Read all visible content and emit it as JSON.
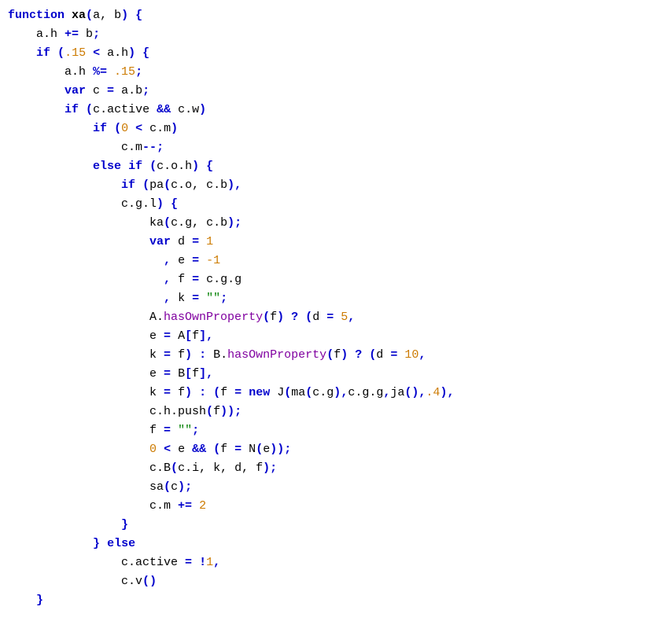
{
  "kw": {
    "function": "function",
    "if": "if",
    "else": "else",
    "var": "var",
    "new": "new"
  },
  "fn": {
    "name": "xa",
    "params": "a, b"
  },
  "expr": {
    "l2": "a.h ",
    "l2b": " b",
    "l3a": ".15",
    "l3b": " a.h",
    "l4a": "a.h ",
    "l4b": " .15",
    "l5a": " c ",
    "l5b": " a.b",
    "l6a": "c.active ",
    "l6b": " c.w",
    "l7a": "0",
    "l7b": " c.m",
    "l8": "c.m",
    "l9": "c.o.h",
    "l10a": "pa",
    "l10b": "c.o, c.b",
    "l11": "c.g.l",
    "l12a": "ka",
    "l12b": "c.g, c.b",
    "l13a": " d ",
    "l13b": "1",
    "l14a": " e ",
    "l14b": "-1",
    "l15a": " f ",
    "l15b": " c.g.g",
    "l16a": " k ",
    "l16b": "\"\"",
    "l17a": "A.",
    "l17p": "hasOwnProperty",
    "l17b": "f",
    "l17c": "d ",
    "l17d": "5",
    "l18a": "e ",
    "l18b": " A",
    "l18c": "f",
    "l19a": "k ",
    "l19b": " f",
    "l19c": "B.",
    "l19p": "hasOwnProperty",
    "l19d": "f",
    "l19e": "d ",
    "l19f": "10",
    "l20a": "e ",
    "l20b": " B",
    "l20c": "f",
    "l21a": "k ",
    "l21b": " f",
    "l21c": "f ",
    "l21d": " J",
    "l21e": "ma",
    "l21f": "c.g",
    "l21g": "c.g.g",
    "l21h": "ja",
    "l21i": ".4",
    "l22a": "c.h.push",
    "l22b": "f",
    "l23a": "f ",
    "l23b": "\"\"",
    "l24a": "0",
    "l24b": " e ",
    "l24c": "f ",
    "l24d": " N",
    "l24e": "e",
    "l25a": "c.B",
    "l25b": "c.i, k, d, f",
    "l26a": "sa",
    "l26b": "c",
    "l27a": "c.m ",
    "l27b": "2",
    "l30a": "c.active ",
    "l30b": "1",
    "l31": "c.v"
  },
  "op": {
    "lbrace": "{",
    "rbrace": "}",
    "lparen": "(",
    "rparen": ")",
    "lbrack": "[",
    "rbrack": "]",
    "semi": ";",
    "comma": ",",
    "pluseq": "+=",
    "lt": "<",
    "modeq": "%=",
    "eq": "=",
    "andand": "&&",
    "minmin": "--",
    "qmark": "?",
    "colon": ":",
    "bang": "!"
  }
}
